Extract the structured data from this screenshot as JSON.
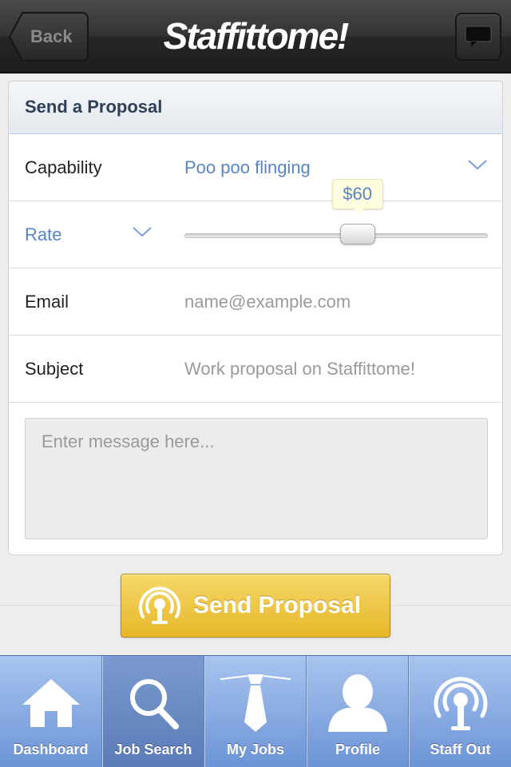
{
  "navbar": {
    "back_label": "Back",
    "logo": "Staffittome!",
    "icons": {
      "back": "back-arrow-button",
      "chat": "speech-bubble-icon"
    }
  },
  "form": {
    "header": "Send a Proposal",
    "capability": {
      "label": "Capability",
      "value": "Poo poo flinging"
    },
    "rate": {
      "label": "Rate",
      "value_text": "$60",
      "slider_fraction": 0.57
    },
    "email": {
      "label": "Email",
      "placeholder": "name@example.com"
    },
    "subject": {
      "label": "Subject",
      "placeholder": "Work proposal on Staffittome!"
    },
    "message": {
      "placeholder": "Enter message here..."
    }
  },
  "send_button": {
    "label": "Send Proposal",
    "icon": "broadcast-icon"
  },
  "tabs": [
    {
      "label": "Dashboard",
      "icon": "home-icon",
      "active": false
    },
    {
      "label": "Job Search",
      "icon": "magnifier-icon",
      "active": true
    },
    {
      "label": "My Jobs",
      "icon": "tie-icon",
      "active": false
    },
    {
      "label": "Profile",
      "icon": "person-icon",
      "active": false
    },
    {
      "label": "Staff Out",
      "icon": "broadcast-icon",
      "active": false
    }
  ],
  "colors": {
    "accent_blue": "#5a85c4",
    "send_button_gold": "#e7b729",
    "tabbar_blue": "#6c94d6",
    "header_text": "#2f4058"
  }
}
